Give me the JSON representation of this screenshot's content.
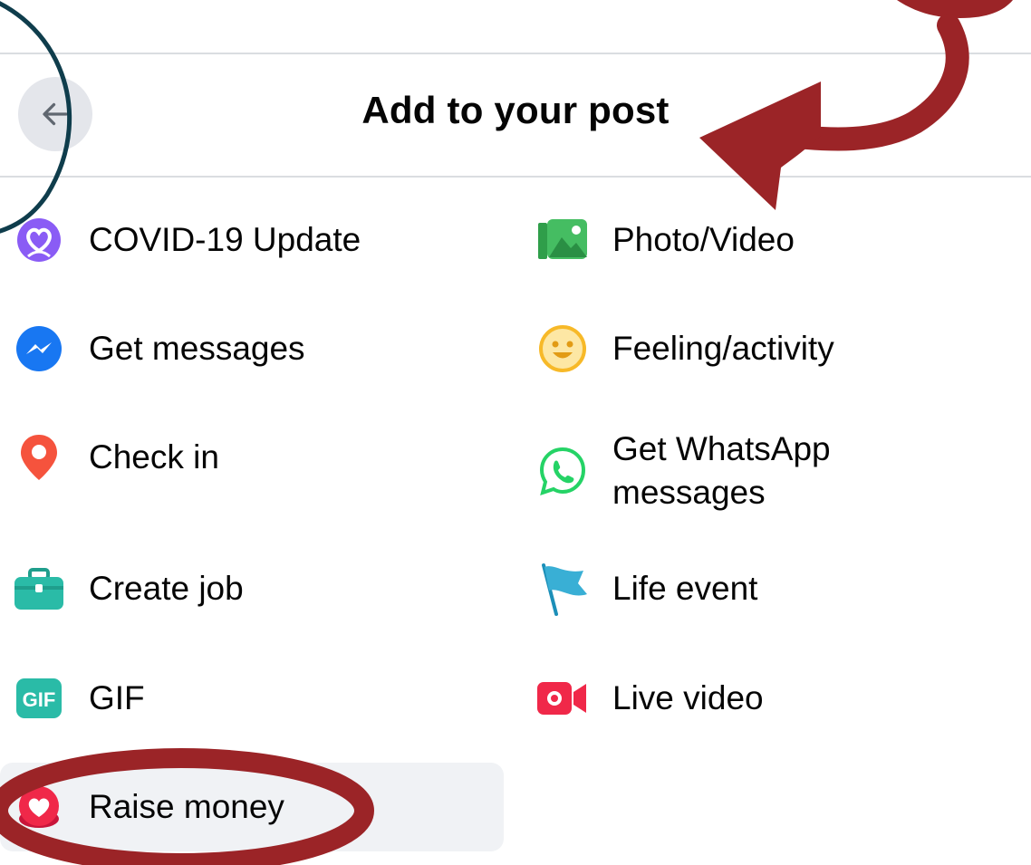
{
  "header": {
    "title": "Add to your post",
    "back_label": "Back"
  },
  "options": {
    "left": [
      {
        "label": "COVID-19 Update",
        "icon": "covid-heart-icon",
        "color": "#8a5cf5"
      },
      {
        "label": "Get messages",
        "icon": "messenger-icon",
        "color": "#1877f2"
      },
      {
        "label": "Check in",
        "icon": "location-pin-icon",
        "color": "#f5533d"
      },
      {
        "label": "Create job",
        "icon": "briefcase-icon",
        "color": "#2abba7"
      },
      {
        "label": "GIF",
        "icon": "gif-icon",
        "color": "#2abba7"
      },
      {
        "label": "Raise money",
        "icon": "fundraiser-heart-icon",
        "color": "#f02849"
      }
    ],
    "right": [
      {
        "label": "Photo/Video",
        "icon": "photo-video-icon",
        "color": "#45bd62"
      },
      {
        "label": "Feeling/activity",
        "icon": "smiley-icon",
        "color": "#f7b928"
      },
      {
        "label": "Get WhatsApp messages",
        "icon": "whatsapp-icon",
        "color": "#25d366"
      },
      {
        "label": "Life event",
        "icon": "flag-icon",
        "color": "#39afd5"
      },
      {
        "label": "Live video",
        "icon": "live-video-camera-icon",
        "color": "#f02849"
      }
    ]
  },
  "annotation_colors": {
    "arrow": "#9b2427",
    "circle_back": "#0f3d4c",
    "circle_raise": "#9b2427"
  }
}
